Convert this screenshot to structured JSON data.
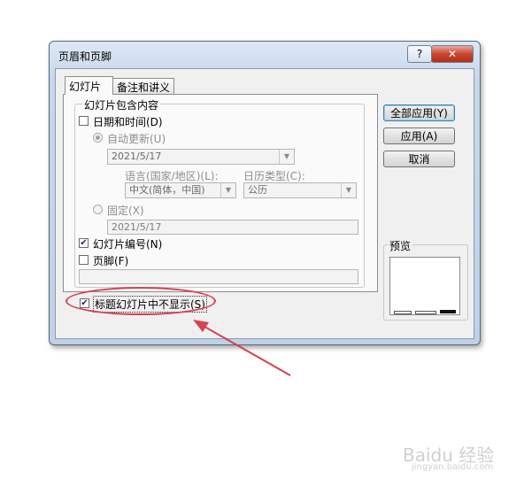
{
  "window": {
    "title": "页眉和页脚",
    "help_label": "?",
    "close_label": "✕"
  },
  "tabs": [
    {
      "label": "幻灯片",
      "active": true
    },
    {
      "label": "备注和讲义",
      "active": false
    }
  ],
  "group": {
    "legend": "幻灯片包含内容",
    "date_time": {
      "label": "日期和时间(D)",
      "checked": false
    },
    "auto_update": {
      "label": "自动更新(U)",
      "selected": true
    },
    "auto_date_value": "2021/5/17",
    "language_label": "语言(国家/地区)(L):",
    "language_value": "中文(简体，中国)",
    "calendar_label": "日历类型(C):",
    "calendar_value": "公历",
    "fixed": {
      "label": "固定(X)",
      "selected": false
    },
    "fixed_date_value": "2021/5/17",
    "slide_number": {
      "label": "幻灯片编号(N)",
      "checked": true
    },
    "footer": {
      "label": "页脚(F)",
      "checked": false
    },
    "footer_value": ""
  },
  "dont_show_on_title": {
    "label": "标题幻灯片中不显示(S)",
    "checked": true
  },
  "buttons": {
    "apply_all": "全部应用(Y)",
    "apply": "应用(A)",
    "cancel": "取消"
  },
  "preview": {
    "label": "预览"
  },
  "watermark": {
    "text": "Baidu 经验",
    "sub": "jingyan.baidu.com"
  },
  "colors": {
    "annotation": "#d8414e",
    "close_button": "#c6452f",
    "default_button_border": "#3c7fb1"
  }
}
